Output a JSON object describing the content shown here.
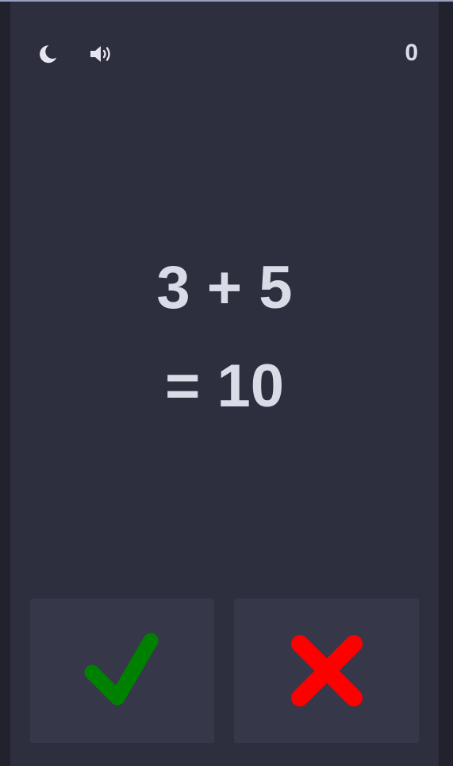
{
  "header": {
    "theme_icon": "moon-icon",
    "sound_icon": "speaker-volume-icon",
    "score": "0"
  },
  "question": {
    "expression": "3 + 5",
    "proposed_answer": "= 10"
  },
  "answers": {
    "correct_icon": "checkmark-icon",
    "correct_color": "#008000",
    "wrong_icon": "cross-icon",
    "wrong_color": "#ff0000"
  },
  "colors": {
    "background": "#2d2e3e",
    "outer_background": "#21222d",
    "button_background": "#363748",
    "text": "#d9dbe7"
  }
}
